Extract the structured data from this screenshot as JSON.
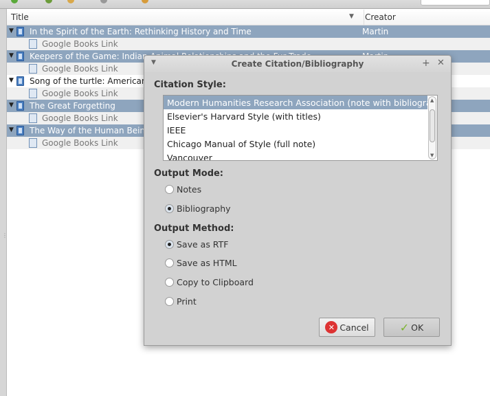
{
  "table": {
    "columns": {
      "title": "Title",
      "creator": "Creator"
    },
    "rows": [
      {
        "type": "book",
        "title": "In the Spirit of the Earth: Rethinking History and Time",
        "creator": "Martin",
        "selected": true
      },
      {
        "type": "link",
        "title": "Google Books Link"
      },
      {
        "type": "book",
        "title": "Keepers of the Game: Indian-Animal Relationships and the Fur Trade",
        "creator": "Martin",
        "selected": true
      },
      {
        "type": "link",
        "title": "Google Books Link"
      },
      {
        "type": "book",
        "title": "Song of the turtle: American",
        "creator": "",
        "selected": false
      },
      {
        "type": "link",
        "title": "Google Books Link"
      },
      {
        "type": "book",
        "title": "The Great Forgetting",
        "creator": "",
        "selected": true
      },
      {
        "type": "link",
        "title": "Google Books Link"
      },
      {
        "type": "book",
        "title": "The Way of the Human Bein",
        "creator": "",
        "selected": true
      },
      {
        "type": "link",
        "title": "Google Books Link"
      }
    ]
  },
  "dialog": {
    "title": "Create Citation/Bibliography",
    "citation_style_label": "Citation Style:",
    "styles": [
      "Modern Humanities Research Association (note with bibliogra...",
      "Elsevier's Harvard Style (with titles)",
      "IEEE",
      "Chicago Manual of Style (full note)",
      "Vancouver"
    ],
    "selected_style": "Modern Humanities Research Association (note with bibliogra...",
    "output_mode_label": "Output Mode:",
    "output_modes": [
      "Notes",
      "Bibliography"
    ],
    "selected_output_mode": "Bibliography",
    "output_method_label": "Output Method:",
    "output_methods": [
      "Save as RTF",
      "Save as HTML",
      "Copy to Clipboard",
      "Print"
    ],
    "selected_output_method": "Save as RTF",
    "cancel_label": "Cancel",
    "ok_label": "OK"
  },
  "colors": {
    "selection": "#8ea5be",
    "dialog_bg": "#d2d2d2"
  }
}
